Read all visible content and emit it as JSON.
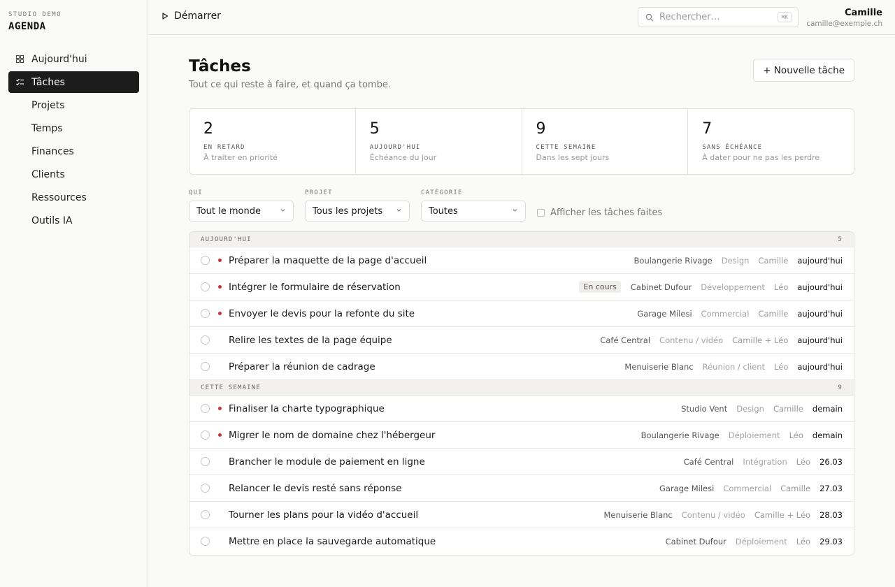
{
  "brand": {
    "small": "STUDIO DEMO",
    "big": "AGENDA"
  },
  "sidebar": {
    "items": [
      {
        "label": "Aujourd'hui",
        "icon": "grid-icon",
        "active": false
      },
      {
        "label": "Tâches",
        "icon": "checklist-icon",
        "active": true
      },
      {
        "label": "Projets",
        "icon": "folder-icon",
        "active": false
      },
      {
        "label": "Temps",
        "icon": "clock-icon",
        "active": false
      },
      {
        "label": "Finances",
        "icon": "card-icon",
        "active": false
      },
      {
        "label": "Clients",
        "icon": "user-icon",
        "active": false
      },
      {
        "label": "Ressources",
        "icon": "bar-chart-icon",
        "active": false
      },
      {
        "label": "Outils IA",
        "icon": "sparkle-icon",
        "active": false
      }
    ]
  },
  "topbar": {
    "start_label": "Démarrer",
    "search_placeholder": "Rechercher…",
    "search_shortcut": "⌘K",
    "user_name": "Camille",
    "user_email": "camille@exemple.ch"
  },
  "page": {
    "title": "Tâches",
    "subtitle": "Tout ce qui reste à faire, et quand ça tombe.",
    "new_task_label": "+ Nouvelle tâche"
  },
  "stats": [
    {
      "value": "2",
      "label": "EN RETARD",
      "sub": "À traiter en priorité"
    },
    {
      "value": "5",
      "label": "AUJOURD'HUI",
      "sub": "Échéance du jour"
    },
    {
      "value": "9",
      "label": "CETTE SEMAINE",
      "sub": "Dans les sept jours"
    },
    {
      "value": "7",
      "label": "SANS ÉCHÉANCE",
      "sub": "À dater pour ne pas les perdre"
    }
  ],
  "filters": {
    "who": {
      "label": "QUI",
      "value": "Tout le monde"
    },
    "project": {
      "label": "PROJET",
      "value": "Tous les projets"
    },
    "category": {
      "label": "CATÉGORIE",
      "value": "Toutes"
    },
    "show_done_label": "Afficher les tâches faites"
  },
  "groups": [
    {
      "name": "AUJOURD'HUI",
      "count": "5",
      "tasks": [
        {
          "title": "Préparer la maquette de la page d'accueil",
          "urgent": true,
          "badge": "",
          "client": "Boulangerie Rivage",
          "category": "Design",
          "assignee": "Camille",
          "due": "aujourd'hui"
        },
        {
          "title": "Intégrer le formulaire de réservation",
          "urgent": true,
          "badge": "En cours",
          "client": "Cabinet Dufour",
          "category": "Développement",
          "assignee": "Léo",
          "due": "aujourd'hui"
        },
        {
          "title": "Envoyer le devis pour la refonte du site",
          "urgent": true,
          "badge": "",
          "client": "Garage Milesi",
          "category": "Commercial",
          "assignee": "Camille",
          "due": "aujourd'hui"
        },
        {
          "title": "Relire les textes de la page équipe",
          "urgent": false,
          "badge": "",
          "client": "Café Central",
          "category": "Contenu / vidéo",
          "assignee": "Camille + Léo",
          "due": "aujourd'hui"
        },
        {
          "title": "Préparer la réunion de cadrage",
          "urgent": false,
          "badge": "",
          "client": "Menuiserie Blanc",
          "category": "Réunion / client",
          "assignee": "Léo",
          "due": "aujourd'hui"
        }
      ]
    },
    {
      "name": "CETTE SEMAINE",
      "count": "9",
      "tasks": [
        {
          "title": "Finaliser la charte typographique",
          "urgent": true,
          "badge": "",
          "client": "Studio Vent",
          "category": "Design",
          "assignee": "Camille",
          "due": "demain"
        },
        {
          "title": "Migrer le nom de domaine chez l'hébergeur",
          "urgent": true,
          "badge": "",
          "client": "Boulangerie Rivage",
          "category": "Déploiement",
          "assignee": "Léo",
          "due": "demain"
        },
        {
          "title": "Brancher le module de paiement en ligne",
          "urgent": false,
          "badge": "",
          "client": "Café Central",
          "category": "Intégration",
          "assignee": "Léo",
          "due": "26.03"
        },
        {
          "title": "Relancer le devis resté sans réponse",
          "urgent": false,
          "badge": "",
          "client": "Garage Milesi",
          "category": "Commercial",
          "assignee": "Camille",
          "due": "27.03"
        },
        {
          "title": "Tourner les plans pour la vidéo d'accueil",
          "urgent": false,
          "badge": "",
          "client": "Menuiserie Blanc",
          "category": "Contenu / vidéo",
          "assignee": "Camille + Léo",
          "due": "28.03"
        },
        {
          "title": "Mettre en place la sauvegarde automatique",
          "urgent": false,
          "badge": "",
          "client": "Cabinet Dufour",
          "category": "Déploiement",
          "assignee": "Léo",
          "due": "29.03"
        }
      ]
    }
  ]
}
